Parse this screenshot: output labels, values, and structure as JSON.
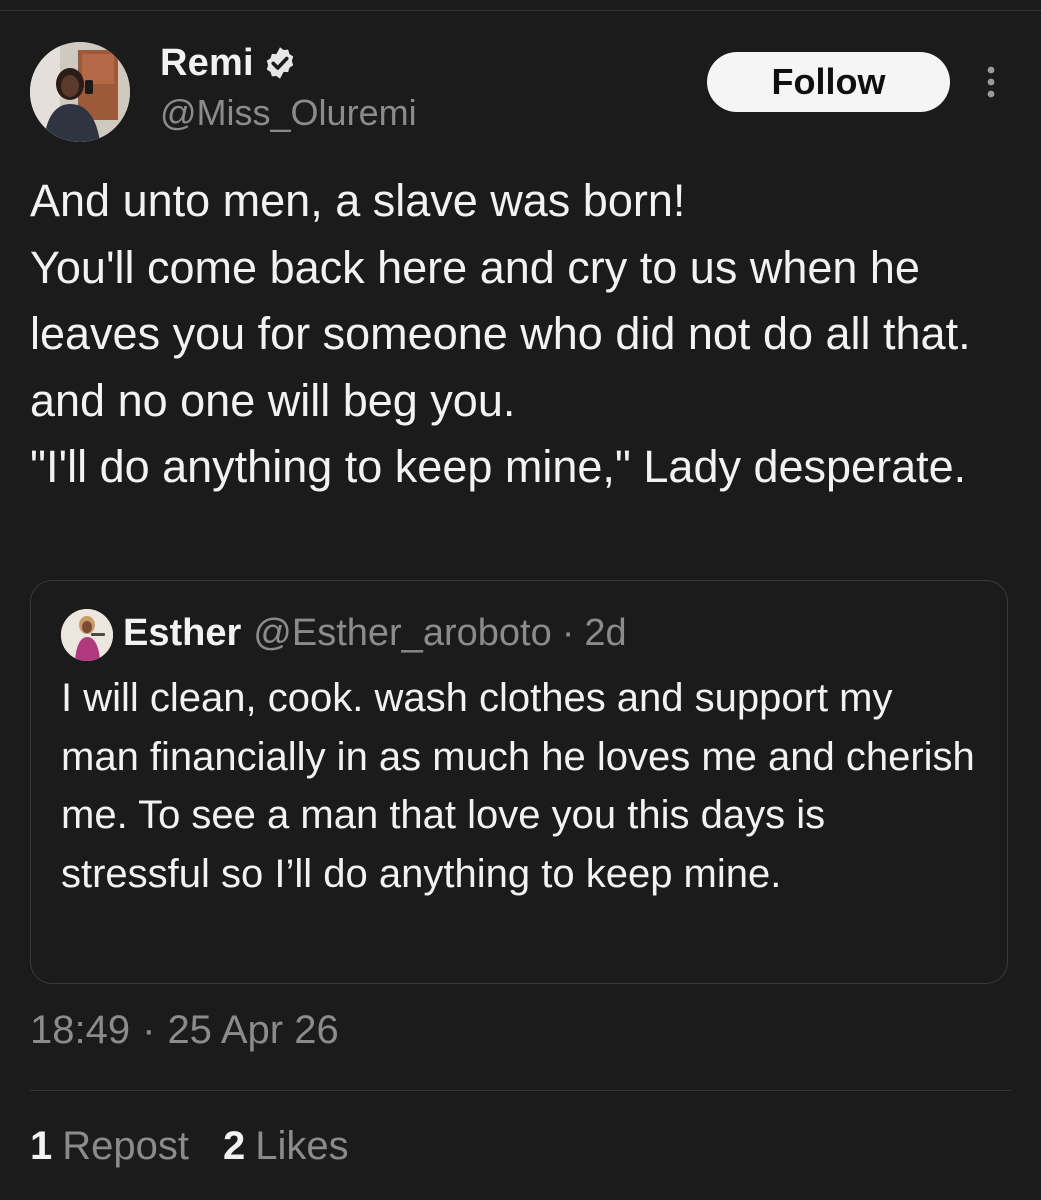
{
  "tweet": {
    "author": {
      "display_name": "Remi",
      "handle": "@Miss_Oluremi",
      "verified": true
    },
    "follow_label": "Follow",
    "text": "And unto men, a slave was born!\nYou'll come back here and cry to us when he leaves you for someone who did not do all that. and no one will beg you.\n\"I'll do anything to keep mine,\" Lady desperate.",
    "time": "18:49",
    "separator": "·",
    "date": "25 Apr 26",
    "stats": {
      "reposts_count": "1",
      "reposts_label": "Repost",
      "likes_count": "2",
      "likes_label": "Likes"
    }
  },
  "quoted_tweet": {
    "author_name": "Esther",
    "author_handle": "@Esther_aroboto",
    "separator": "·",
    "age": "2d",
    "text": "I will clean, cook. wash clothes and support my man financially in as much he loves me and cherish me. To see a man that love you this days is stressful so I’ll do anything to keep mine."
  },
  "colors": {
    "background": "#1b1b1b",
    "text_primary": "#f2f2f2",
    "text_secondary": "#8b8b8b",
    "follow_button_bg": "#f5f5f5",
    "verified_badge": "#e6e6e6"
  },
  "icons": {
    "verified": "verified-badge-icon",
    "more": "more-vertical-icon"
  }
}
